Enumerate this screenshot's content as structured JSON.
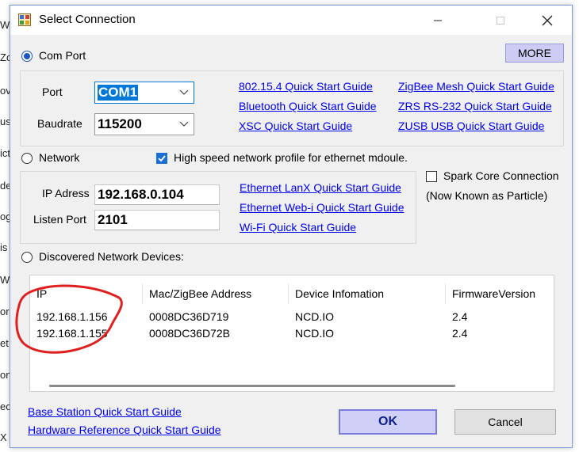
{
  "background_letters": [
    "W",
    "Zo",
    "ov",
    "us",
    "ict",
    "de",
    "og",
    "is",
    "W",
    "or",
    "et",
    "on",
    "ec",
    "X"
  ],
  "window": {
    "title": "Select Connection"
  },
  "com_port": {
    "radio_label": "Com Port",
    "more_label": "MORE",
    "port_label": "Port",
    "port_value": "COM1",
    "baud_label": "Baudrate",
    "baud_value": "115200",
    "guides": [
      "802.15.4 Quick Start Guide",
      "ZigBee Mesh Quick Start Guide",
      "Bluetooth Quick Start Guide",
      "ZRS RS-232 Quick Start Guide",
      "XSC Quick Start Guide",
      "ZUSB USB Quick Start Guide"
    ]
  },
  "network": {
    "radio_label": "Network",
    "high_speed_label": "High speed network profile for ethernet mdoule.",
    "ip_label": "IP Adress",
    "ip_value": "192.168.0.104",
    "port_label": "Listen Port",
    "port_value": "2101",
    "guides": [
      "Ethernet LanX Quick Start Guide",
      "Ethernet Web-i Quick Start Guide",
      "Wi-Fi Quick Start Guide"
    ],
    "spark_label": "Spark Core Connection",
    "spark_note": "(Now Known as Particle)"
  },
  "discovered": {
    "radio_label": "Discovered Network Devices:",
    "columns": [
      "IP",
      "Mac/ZigBee Address",
      "Device Infomation",
      "FirmwareVersion"
    ],
    "rows": [
      [
        "192.168.1.156",
        "0008DC36D719",
        "NCD.IO",
        "2.4"
      ],
      [
        "192.168.1.155",
        "0008DC36D72B",
        "NCD.IO",
        "2.4"
      ]
    ]
  },
  "footer": {
    "links": [
      "Base Station Quick Start Guide",
      "Hardware Reference Quick Start Guide"
    ],
    "ok_label": "OK",
    "cancel_label": "Cancel"
  },
  "colors": {
    "link": "#0000ee",
    "ok_button": "#cfcff7",
    "annotation": "#e02020"
  }
}
